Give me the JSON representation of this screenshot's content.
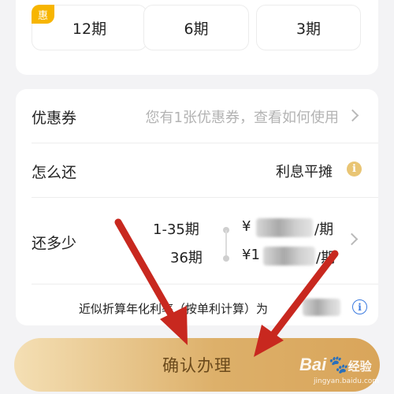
{
  "installments": {
    "badge": "惠",
    "options": [
      "12期",
      "6期",
      "3期"
    ]
  },
  "coupon": {
    "label": "优惠券",
    "hint": "您有1张优惠券，查看如何使用"
  },
  "repay_method": {
    "label": "怎么还",
    "value": "利息平摊"
  },
  "repay_amount": {
    "label": "还多少",
    "schedule": [
      {
        "period": "1-35期",
        "currency": "¥",
        "suffix": "/期"
      },
      {
        "period": "36期",
        "currency": "¥1",
        "suffix": "/期"
      }
    ]
  },
  "apr": {
    "text": "近似折算年化利率（按单利计算）为"
  },
  "confirm_button": {
    "label": "确认办理"
  },
  "watermark": {
    "brand": "Bai",
    "brand_tail": "经验",
    "url": "jingyan.baidu.com"
  },
  "colors": {
    "accent_gold": "#d9a55a",
    "badge_yellow": "#f7b500",
    "annotation_red": "#c8281f",
    "info_blue": "#3c7be0"
  },
  "icons": [
    "chevron-right-icon",
    "info-icon",
    "annotation-arrow-icon",
    "paw-icon"
  ]
}
